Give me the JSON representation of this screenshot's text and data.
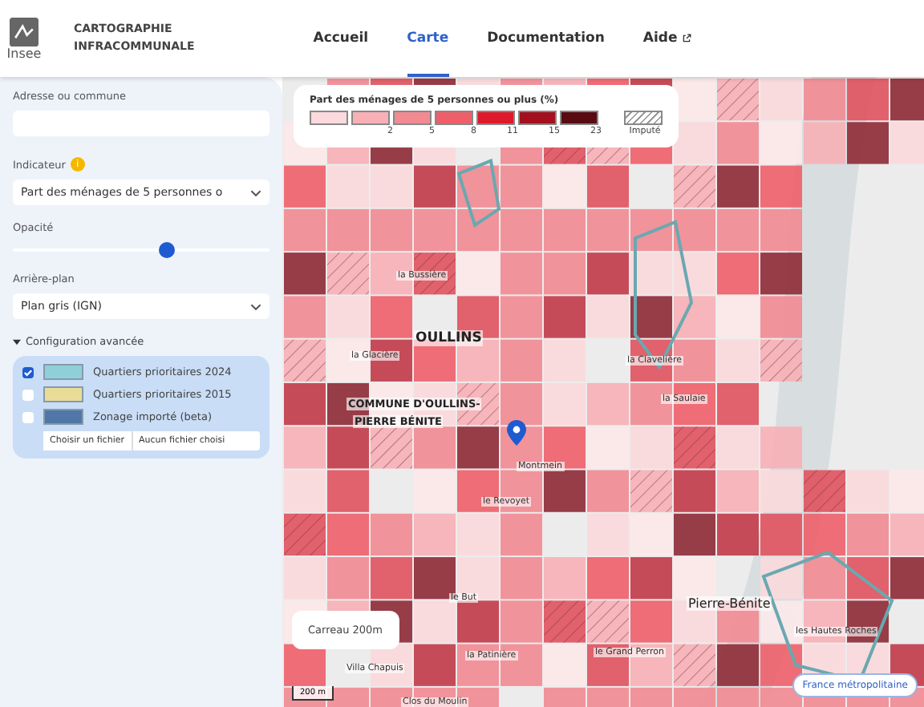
{
  "header": {
    "logo_text": "Insee",
    "site_title": [
      "CARTOGRAPHIE",
      "INFRACOMMUNALE"
    ],
    "nav": [
      {
        "label": "Accueil",
        "selected": false,
        "external": false
      },
      {
        "label": "Carte",
        "selected": true,
        "external": false
      },
      {
        "label": "Documentation",
        "selected": false,
        "external": false
      },
      {
        "label": "Aide",
        "selected": false,
        "external": true
      }
    ]
  },
  "sidebar": {
    "address": {
      "label": "Adresse ou commune"
    },
    "indicator": {
      "label": "Indicateur",
      "info": "i",
      "value": "Part des ménages de 5 personnes o"
    },
    "opacity": {
      "label": "Opacité",
      "level": 0.6
    },
    "background": {
      "label": "Arrière-plan",
      "value": "Plan gris (IGN)"
    },
    "advanced": {
      "label": "Configuration avancée",
      "expanded": true,
      "layers": [
        {
          "label": "Quartiers prioritaires 2024",
          "checked": true,
          "color": "#8fd0d8"
        },
        {
          "label": "Quartiers prioritaires 2015",
          "checked": false,
          "color": "#e8dc98"
        },
        {
          "label": "Zonage importé (beta)",
          "checked": false,
          "color": "#4f78a8"
        }
      ],
      "file_button": "Choisir un fichier",
      "file_status": "Aucun fichier choisi"
    }
  },
  "legend": {
    "title": "Part des ménages de 5 personnes ou plus (%)",
    "classes": [
      {
        "color": "#fbd9dc"
      },
      {
        "color": "#f7b0b6",
        "label": "2"
      },
      {
        "color": "#f28a92",
        "label": "5"
      },
      {
        "color": "#ee5f69",
        "label": "8"
      },
      {
        "color": "#e0192a",
        "label": "11"
      },
      {
        "color": "#a3101e",
        "label": "15"
      },
      {
        "color": "#5a0a12",
        "label": "23"
      }
    ],
    "imputed_label": "Imputé"
  },
  "map": {
    "places": [
      "la Bussière",
      "OULLINS",
      "la Glacière",
      "la Clavelière",
      "la Saulaie",
      "COMMUNE D'OULLINS-",
      "PIERRE BÉNITE",
      "Montmein",
      "le Revoyet",
      "le But",
      "Pierre-Bénite",
      "les Hautes Roches",
      "le Grand Perron",
      "la Patinière",
      "Villa Chapuis",
      "Clos du Moulin"
    ],
    "tile_size": "Carreau 200m",
    "scale": "200 m",
    "region_button": "France métropolitaine"
  }
}
